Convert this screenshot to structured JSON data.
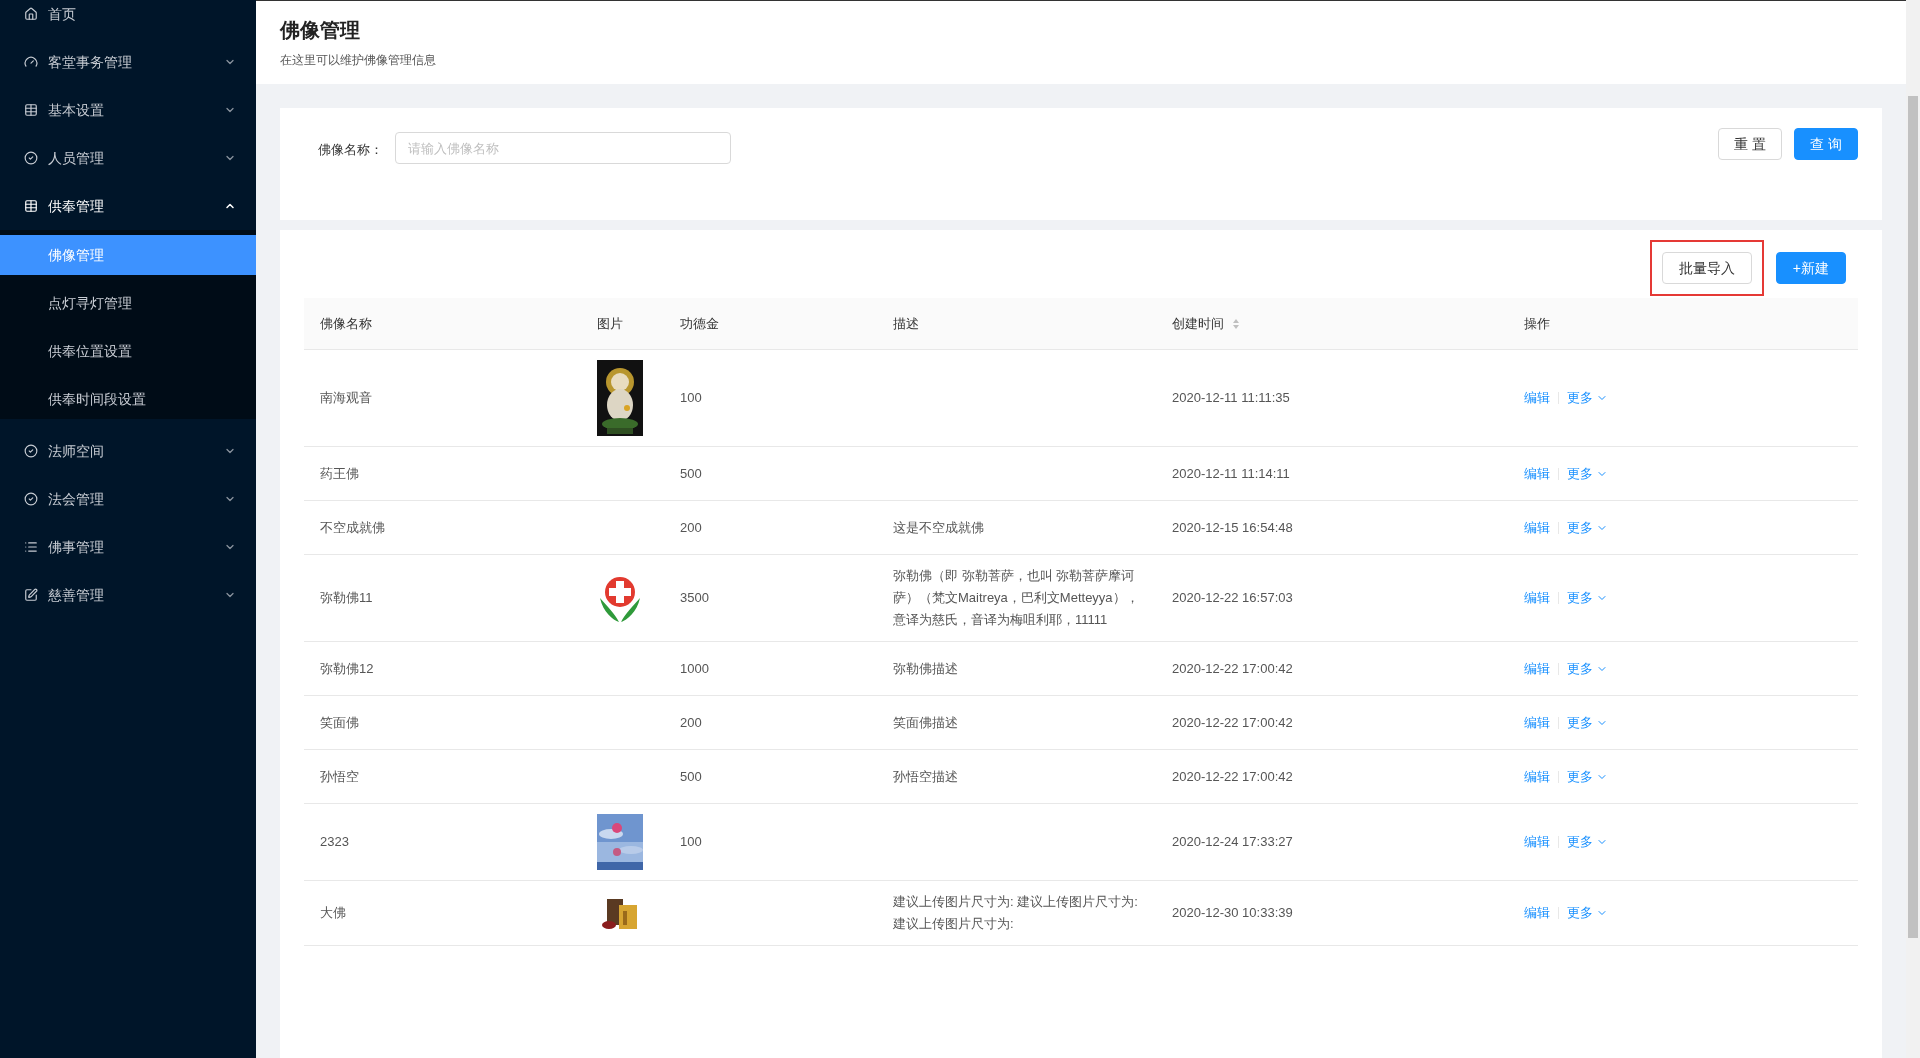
{
  "sidebar": {
    "items": [
      {
        "label": "首页",
        "expanded": false,
        "has_children": false
      },
      {
        "label": "客堂事务管理",
        "expanded": false,
        "has_children": true
      },
      {
        "label": "基本设置",
        "expanded": false,
        "has_children": true
      },
      {
        "label": "人员管理",
        "expanded": false,
        "has_children": true
      },
      {
        "label": "供奉管理",
        "expanded": true,
        "has_children": true,
        "children": [
          {
            "label": "佛像管理",
            "selected": true
          },
          {
            "label": "点灯寻灯管理",
            "selected": false
          },
          {
            "label": "供奉位置设置",
            "selected": false
          },
          {
            "label": "供奉时间段设置",
            "selected": false
          }
        ]
      },
      {
        "label": "法师空间",
        "expanded": false,
        "has_children": true
      },
      {
        "label": "法会管理",
        "expanded": false,
        "has_children": true
      },
      {
        "label": "佛事管理",
        "expanded": false,
        "has_children": true
      },
      {
        "label": "慈善管理",
        "expanded": false,
        "has_children": true
      }
    ]
  },
  "header": {
    "title": "佛像管理",
    "subtitle": "在这里可以维护佛像管理信息"
  },
  "search": {
    "label": "佛像名称：",
    "placeholder": "请输入佛像名称",
    "buttons": [
      {
        "label": "重 置",
        "kind": "default"
      },
      {
        "label": "查 询",
        "kind": "primary"
      }
    ]
  },
  "toolbar": {
    "buttons": [
      {
        "label": "批量导入",
        "kind": "default",
        "highlighted": true
      },
      {
        "label": "+新建",
        "kind": "primary",
        "highlighted": false
      }
    ]
  },
  "table": {
    "columns": [
      {
        "label": "佛像名称",
        "sortable": false
      },
      {
        "label": "图片",
        "sortable": false
      },
      {
        "label": "功德金",
        "sortable": false
      },
      {
        "label": "描述",
        "sortable": false
      },
      {
        "label": "创建时间",
        "sortable": true
      },
      {
        "label": "操作",
        "sortable": false
      }
    ],
    "rows": [
      {
        "name": "南海观音",
        "merit": "100",
        "created": "2020-12-11 11:11:35",
        "actions": [
          "编辑",
          "更多"
        ]
      },
      {
        "name": "药王佛",
        "merit": "500",
        "created": "2020-12-11 11:14:11",
        "actions": [
          "编辑",
          "更多"
        ]
      },
      {
        "name": "不空成就佛",
        "merit": "200",
        "description": "这是不空成就佛",
        "created": "2020-12-15 16:54:48",
        "actions": [
          "编辑",
          "更多"
        ]
      },
      {
        "name": "弥勒佛11",
        "merit": "3500",
        "description": "弥勒佛（即 弥勒菩萨，也叫 弥勒菩萨摩诃萨）（梵文Maitreya，巴利文Metteyya），意译为慈氏，音译为梅咀利耶，11111",
        "created": "2020-12-22 16:57:03",
        "actions": [
          "编辑",
          "更多"
        ]
      },
      {
        "name": "弥勒佛12",
        "merit": "1000",
        "description": "弥勒佛描述",
        "created": "2020-12-22 17:00:42",
        "actions": [
          "编辑",
          "更多"
        ]
      },
      {
        "name": "笑面佛",
        "merit": "200",
        "description": "笑面佛描述",
        "created": "2020-12-22 17:00:42",
        "actions": [
          "编辑",
          "更多"
        ]
      },
      {
        "name": "孙悟空",
        "merit": "500",
        "description": "孙悟空描述",
        "created": "2020-12-22 17:00:42",
        "actions": [
          "编辑",
          "更多"
        ]
      },
      {
        "name": "2323",
        "merit": "100",
        "created": "2020-12-24 17:33:27",
        "actions": [
          "编辑",
          "更多"
        ]
      },
      {
        "name": "大佛",
        "description": "建议上传图片尺寸为: 建议上传图片尺寸为: 建议上传图片尺寸为:",
        "created": "2020-12-30 10:33:39",
        "actions": [
          "编辑",
          "更多"
        ]
      }
    ]
  }
}
